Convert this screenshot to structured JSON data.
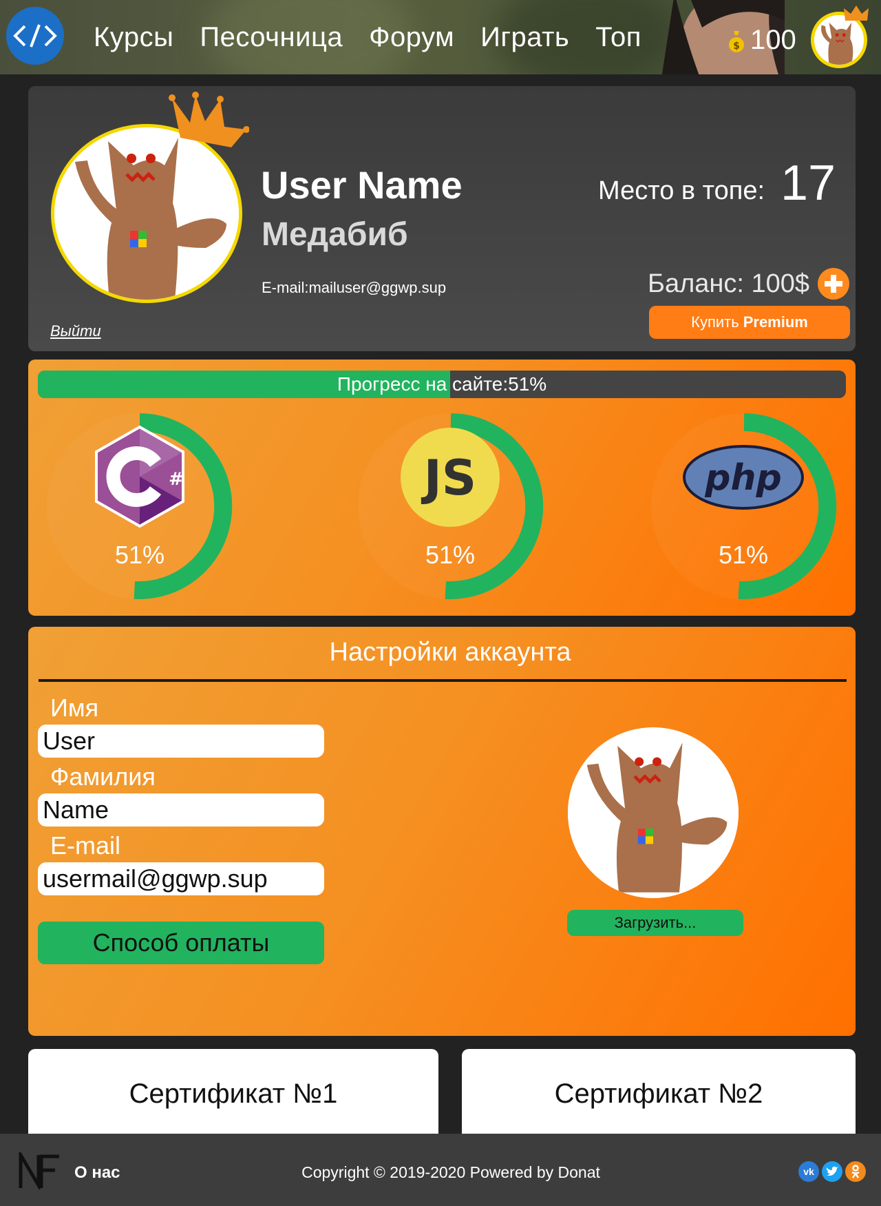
{
  "nav": {
    "items": [
      "Курсы",
      "Песочница",
      "Форум",
      "Играть",
      "Топ"
    ],
    "coins": "100"
  },
  "profile": {
    "name": "User Name",
    "nickname": "Медабиб",
    "email": "E-mail:mailuser@ggwp.sup",
    "logout": "Выйти",
    "rank_label": "Место в топе:",
    "rank_value": "17",
    "balance": "Баланс: 100$",
    "buy_prefix": "Купить",
    "buy_premium": "Premium"
  },
  "progress": {
    "label": "Прогресс на сайте:51%",
    "value": 0.51,
    "languages": [
      {
        "icon": "csharp-icon",
        "percent": "51%",
        "value": 0.51
      },
      {
        "icon": "javascript-icon",
        "percent": "51%",
        "value": 0.51
      },
      {
        "icon": "php-icon",
        "percent": "51%",
        "value": 0.51
      }
    ]
  },
  "settings": {
    "title": "Настройки аккаунта",
    "first_name_label": "Имя",
    "first_name_value": "User",
    "last_name_label": "Фамилия",
    "last_name_value": "Name",
    "email_label": "E-mail",
    "email_value": "usermail@ggwp.sup",
    "payment_button": "Способ оплаты",
    "upload_button": "Загрузить..."
  },
  "certificates": [
    "Сертификат №1",
    "Сертификат №2"
  ],
  "footer": {
    "about": "О нас",
    "copyright": "Copyright © 2019-2020 Powered by Donat",
    "social": [
      "vk-icon",
      "twitter-icon",
      "odnoklassniki-icon"
    ]
  },
  "colors": {
    "accent_orange": "#ff7d14",
    "progress_green": "#22b35e",
    "avatar_border": "#f5d800",
    "logo_blue": "#1b6fc7"
  }
}
